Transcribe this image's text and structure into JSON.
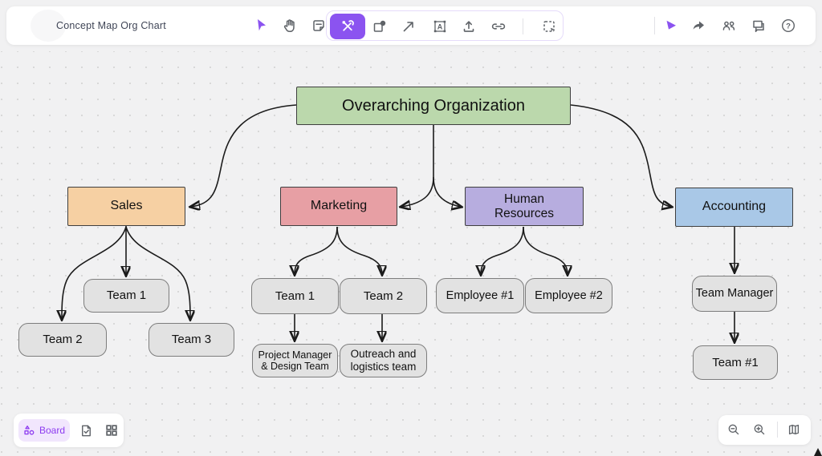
{
  "header": {
    "title": "Concept Map Org Chart",
    "glyphs": {
      "help": "?",
      "text_tool": "A"
    },
    "left_tools": [
      "select",
      "hand",
      "sticky-note"
    ],
    "tool_group": [
      "tools (active)",
      "shapes",
      "connector-arrow",
      "text-frame",
      "upload",
      "link",
      "marquee-select"
    ],
    "right_tools": [
      "laser-pointer",
      "share",
      "collaborators",
      "comments",
      "help"
    ]
  },
  "footer": {
    "board_label": "Board",
    "left_tools": [
      "board-switcher",
      "template-check",
      "widgets-grid"
    ],
    "right_tools": [
      "zoom-out",
      "zoom-in",
      "minimap"
    ]
  },
  "colors": {
    "accent": "#8b53f0",
    "root_green": "#bbd8ac",
    "sales_peach": "#f6d0a3",
    "marketing_pink": "#e79fa4",
    "hr_lavender": "#b7addf",
    "accounting_blue": "#a9c8e7",
    "leaf_gray": "#e2e2e2",
    "edge_black": "#1b1b1b"
  },
  "diagram": {
    "nodes": {
      "root": {
        "label": "Overarching Organization"
      },
      "sales": {
        "label": "Sales"
      },
      "marketing": {
        "label": "Marketing"
      },
      "hr": {
        "label": "Human Resources"
      },
      "accounting": {
        "label": "Accounting"
      },
      "sales_team1": {
        "label": "Team 1"
      },
      "sales_team2": {
        "label": "Team 2"
      },
      "sales_team3": {
        "label": "Team 3"
      },
      "mkt_team1": {
        "label": "Team 1"
      },
      "mkt_team2": {
        "label": "Team 2"
      },
      "mkt_pm": {
        "label": "Project Manager & Design Team"
      },
      "mkt_outreach": {
        "label": "Outreach and logistics team"
      },
      "hr_emp1": {
        "label": "Employee #1"
      },
      "hr_emp2": {
        "label": "Employee #2"
      },
      "acct_mgr": {
        "label": "Team Manager"
      },
      "acct_team1": {
        "label": "Team #1"
      }
    },
    "edges": [
      {
        "from": "root",
        "to": "sales"
      },
      {
        "from": "root",
        "to": "marketing"
      },
      {
        "from": "root",
        "to": "hr"
      },
      {
        "from": "root",
        "to": "accounting"
      },
      {
        "from": "sales",
        "to": "sales_team1"
      },
      {
        "from": "sales",
        "to": "sales_team2"
      },
      {
        "from": "sales",
        "to": "sales_team3"
      },
      {
        "from": "marketing",
        "to": "mkt_team1"
      },
      {
        "from": "marketing",
        "to": "mkt_team2"
      },
      {
        "from": "mkt_team1",
        "to": "mkt_pm"
      },
      {
        "from": "mkt_team2",
        "to": "mkt_outreach"
      },
      {
        "from": "hr",
        "to": "hr_emp1"
      },
      {
        "from": "hr",
        "to": "hr_emp2"
      },
      {
        "from": "accounting",
        "to": "acct_mgr"
      },
      {
        "from": "acct_mgr",
        "to": "acct_team1"
      }
    ]
  }
}
